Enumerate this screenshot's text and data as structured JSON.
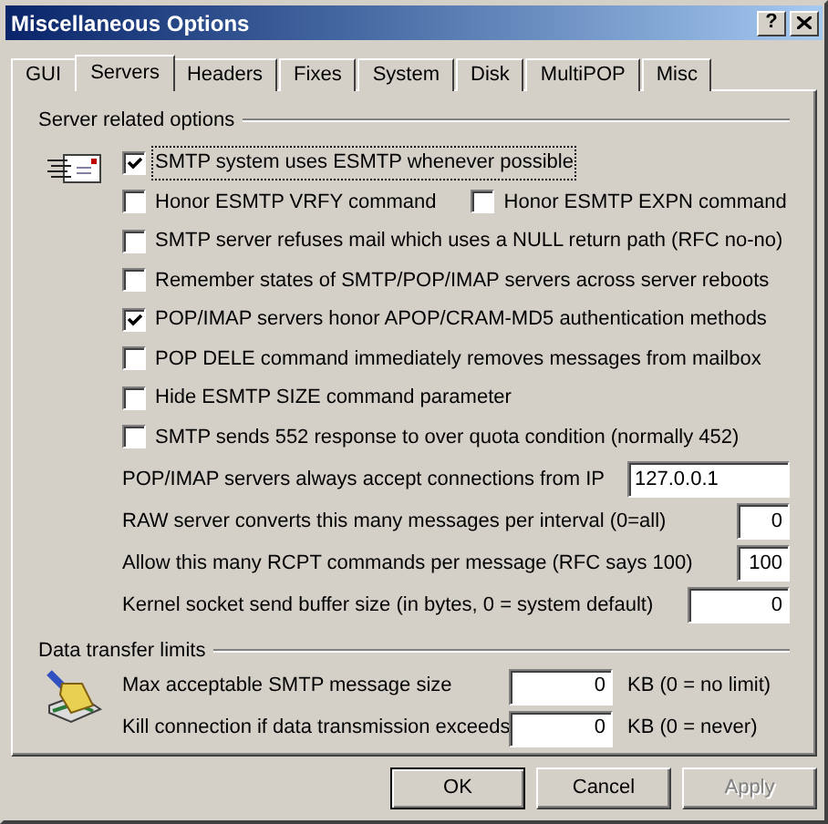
{
  "window": {
    "title": "Miscellaneous Options",
    "help_button": "?"
  },
  "tabs": [
    {
      "label": "GUI",
      "selected": false
    },
    {
      "label": "Servers",
      "selected": true
    },
    {
      "label": "Headers",
      "selected": false
    },
    {
      "label": "Fixes",
      "selected": false
    },
    {
      "label": "System",
      "selected": false
    },
    {
      "label": "Disk",
      "selected": false
    },
    {
      "label": "MultiPOP",
      "selected": false
    },
    {
      "label": "Misc",
      "selected": false
    }
  ],
  "server_group": {
    "title": "Server related options",
    "checkbox_rows": [
      [
        {
          "label": "SMTP system uses ESMTP whenever possible",
          "checked": true,
          "focused": true
        }
      ],
      [
        {
          "label": "Honor ESMTP VRFY command",
          "checked": false,
          "focused": false
        },
        {
          "label": "Honor ESMTP EXPN command",
          "checked": false,
          "focused": false
        }
      ],
      [
        {
          "label": "SMTP server refuses mail which uses a NULL return path (RFC no-no)",
          "checked": false,
          "focused": false
        }
      ],
      [
        {
          "label": "Remember states of SMTP/POP/IMAP servers across server reboots",
          "checked": false,
          "focused": false
        }
      ],
      [
        {
          "label": "POP/IMAP servers honor APOP/CRAM-MD5 authentication methods",
          "checked": true,
          "focused": false
        }
      ],
      [
        {
          "label": "POP DELE command immediately removes messages from mailbox",
          "checked": false,
          "focused": false
        }
      ],
      [
        {
          "label": "Hide ESMTP SIZE command parameter",
          "checked": false,
          "focused": false
        }
      ],
      [
        {
          "label": "SMTP sends 552 response to over quota condition (normally 452)",
          "checked": false,
          "focused": false
        }
      ]
    ],
    "fields": [
      {
        "label": "POP/IMAP servers always accept connections from IP",
        "value": "127.0.0.1",
        "kind": "text"
      },
      {
        "label": "RAW server converts this many messages per interval (0=all)",
        "value": "0",
        "kind": "number"
      },
      {
        "label": "Allow this many RCPT commands per message (RFC says 100)",
        "value": "100",
        "kind": "number"
      },
      {
        "label": "Kernel socket send buffer size (in bytes, 0 = system default)",
        "value": "0",
        "kind": "number"
      }
    ]
  },
  "data_group": {
    "title": "Data transfer limits",
    "fields": [
      {
        "label": "Max acceptable SMTP message size",
        "value": "0",
        "unit": "KB (0 = no limit)"
      },
      {
        "label": "Kill connection if data transmission exceeds",
        "value": "0",
        "unit": "KB (0 = never)"
      }
    ]
  },
  "buttons": [
    {
      "label": "OK",
      "default": true,
      "disabled": false
    },
    {
      "label": "Cancel",
      "default": false,
      "disabled": false
    },
    {
      "label": "Apply",
      "default": false,
      "disabled": true
    }
  ]
}
